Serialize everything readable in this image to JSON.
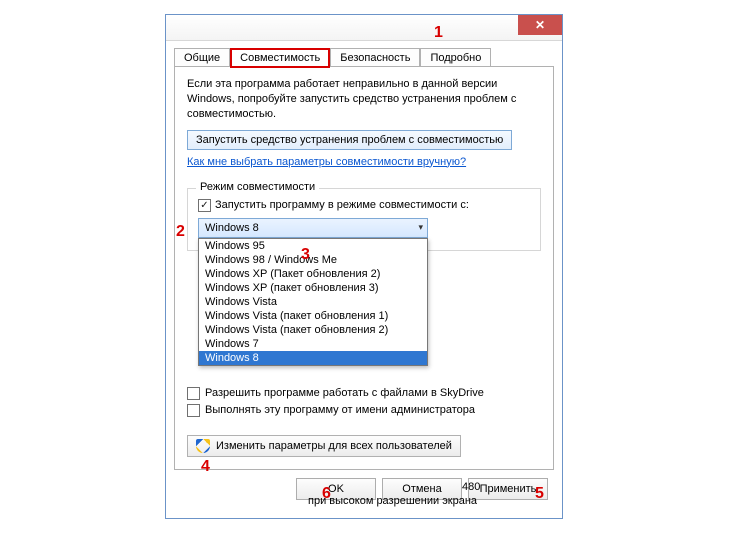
{
  "annotations": {
    "a1": "1",
    "a2": "2",
    "a3": "3",
    "a4": "4",
    "a5": "5",
    "a6": "6"
  },
  "titlebar": {
    "close": "✕"
  },
  "tabs": {
    "general": "Общие",
    "compat": "Совместимость",
    "security": "Безопасность",
    "details": "Подробно"
  },
  "intro": "Если эта программа работает неправильно в данной версии Windows, попробуйте запустить средство устранения проблем с совместимостью.",
  "troubleshoot_btn": "Запустить средство устранения проблем с совместимостью",
  "help_link": "Как мне выбрать параметры совместимости вручную?",
  "compat_group": {
    "legend": "Режим совместимости",
    "checkbox_label": "Запустить программу в режиме совместимости с:",
    "selected": "Windows 8",
    "options": [
      "Windows 95",
      "Windows 98 / Windows Me",
      "Windows XP (Пакет обновления 2)",
      "Windows XP (пакет обновления 3)",
      "Windows Vista",
      "Windows Vista (пакет обновления 1)",
      "Windows Vista (пакет обновления 2)",
      "Windows 7",
      "Windows 8"
    ]
  },
  "fragments": {
    "num480": "480",
    "hidpi": "при высоком разрешении экрана"
  },
  "checks": {
    "skydrive": "Разрешить программе работать с файлами в SkyDrive",
    "admin": "Выполнять эту программу от имени администратора"
  },
  "all_users_btn": "Изменить параметры для всех пользователей",
  "footer": {
    "ok": "OK",
    "cancel": "Отмена",
    "apply": "Применить"
  }
}
